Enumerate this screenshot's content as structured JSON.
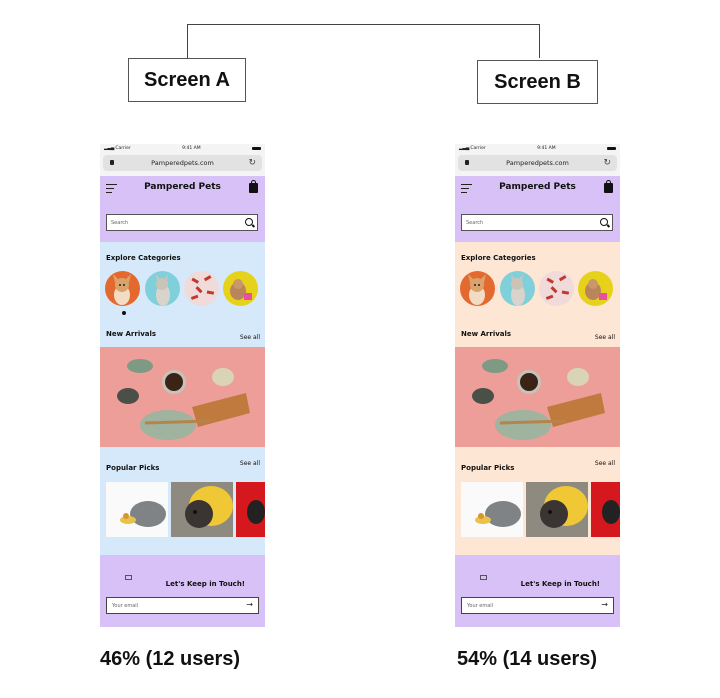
{
  "labels": {
    "screen_a": "Screen A",
    "screen_b": "Screen B"
  },
  "results": {
    "screen_a": "46% (12 users)",
    "screen_b": "54% (14 users)"
  },
  "phone": {
    "carrier": "Carrier",
    "time": "9:41 AM",
    "url": "Pamperedpets.com",
    "brand": "Pampered Pets",
    "search_placeholder": "Search",
    "explore_title": "Explore Categories",
    "new_arrivals_title": "New Arrivals",
    "popular_picks_title": "Popular Picks",
    "see_all": "See all",
    "keep_in_touch": "Let's Keep in Touch!",
    "email_placeholder": "Your email"
  },
  "colors": {
    "header": "#d8c1f6",
    "screen_a_background": "#d5e9fa",
    "screen_b_background": "#fde6d4"
  }
}
